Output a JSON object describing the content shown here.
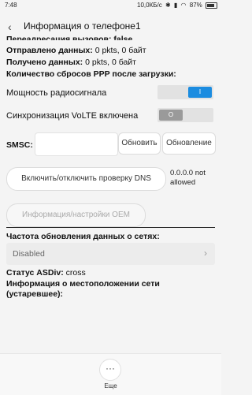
{
  "status_bar": {
    "time": "7:48",
    "network_speed": "10,0КБ/с",
    "battery": "87%"
  },
  "header": {
    "title": "Информация о телефоне1"
  },
  "info": {
    "redirect_line": "Переадресация вызовов: false",
    "sent_label": "Отправлено данных:",
    "sent_value": "0 pkts, 0 байт",
    "received_label": "Получено данных:",
    "received_value": "0 pkts, 0 байт",
    "ppp_label": "Количество сбросов PPP после загрузки:"
  },
  "toggles": {
    "radio_power": {
      "label": "Мощность радиосигнала",
      "state_text": "I",
      "on": true
    },
    "volte_sync": {
      "label": "Синхронизация VoLTE включена",
      "state_text": "O",
      "on": false
    }
  },
  "smsc": {
    "label": "SMSC:",
    "value": "",
    "refresh_button": "Обновить",
    "update_button": "Обновление"
  },
  "dns": {
    "toggle_button": "Включить/отключить проверку DNS",
    "status": "0.0.0.0 not allowed"
  },
  "oem": {
    "button": "Информация/настройки OEM"
  },
  "network_refresh": {
    "label": "Частота обновления данных о сетях:",
    "selected": "Disabled"
  },
  "asdiv": {
    "label": "Статус ASDiv:",
    "value": "cross"
  },
  "location": {
    "label": "Информация о местоположении сети (устаревшее):"
  },
  "footer": {
    "more_label": "Еще",
    "more_glyph": "···"
  }
}
